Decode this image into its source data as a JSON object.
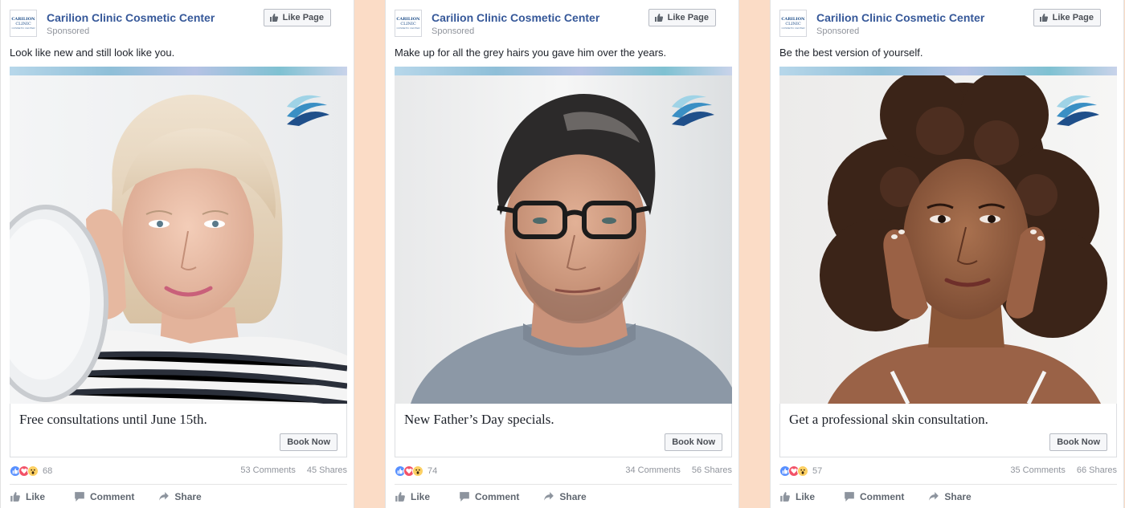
{
  "colors": {
    "background": "#fbdcc6",
    "page_name": "#365899",
    "reaction_like": "#5890ff",
    "reaction_love": "#f25268",
    "reaction_wow": "#fcd063"
  },
  "ads": [
    {
      "page_name": "Carilion Clinic Cosmetic Center",
      "sponsored": "Sponsored",
      "like_page": "Like Page",
      "caption": "Look like new and still look like you.",
      "headline": "Free consultations until June 15th.",
      "cta": "Book Now",
      "reaction_count": "68",
      "comments": "53 Comments",
      "shares": "45 Shares",
      "actions": {
        "like": "Like",
        "comment": "Comment",
        "share": "Share"
      },
      "photo": "woman-with-mirror"
    },
    {
      "page_name": "Carilion Clinic Cosmetic Center",
      "sponsored": "Sponsored",
      "like_page": "Like Page",
      "caption": "Make up for all the grey hairs you gave him over the years.",
      "headline": "New Father’s Day specials.",
      "cta": "Book Now",
      "reaction_count": "74",
      "comments": "34 Comments",
      "shares": "56 Shares",
      "actions": {
        "like": "Like",
        "comment": "Comment",
        "share": "Share"
      },
      "photo": "man-with-glasses"
    },
    {
      "page_name": "Carilion Clinic Cosmetic Center",
      "sponsored": "Sponsored",
      "like_page": "Like Page",
      "caption": "Be the best version of yourself.",
      "headline": "Get a professional skin consultation.",
      "cta": "Book Now",
      "reaction_count": "57",
      "comments": "35 Comments",
      "shares": "66 Shares",
      "actions": {
        "like": "Like",
        "comment": "Comment",
        "share": "Share"
      },
      "photo": "woman-curly-hair"
    }
  ],
  "logo": {
    "line1": "CARILION",
    "line2": "CLINIC",
    "line3": "COSMETIC CENTER"
  }
}
